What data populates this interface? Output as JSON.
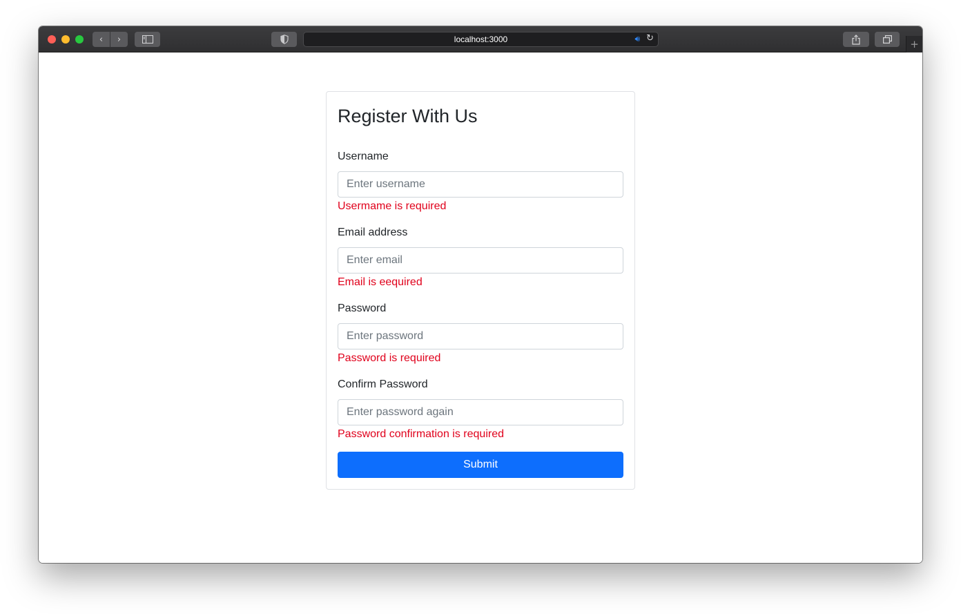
{
  "browser": {
    "address": "localhost:3000",
    "icons": {
      "back": "chevron-left-icon",
      "forward": "chevron-right-icon",
      "sidebar": "sidebar-icon",
      "shield": "shield-icon",
      "speaker": "speaker-icon",
      "reload": "reload-icon",
      "share": "share-icon",
      "tabs": "tabs-overview-icon",
      "new_tab": "plus-icon"
    }
  },
  "form": {
    "title": "Register With Us",
    "fields": [
      {
        "label": "Username",
        "placeholder": "Enter username",
        "value": "",
        "error": "Usermame is required"
      },
      {
        "label": "Email address",
        "placeholder": "Enter email",
        "value": "",
        "error": "Email is eequired"
      },
      {
        "label": "Password",
        "placeholder": "Enter password",
        "value": "",
        "error": "Password is required"
      },
      {
        "label": "Confirm Password",
        "placeholder": "Enter password again",
        "value": "",
        "error": "Password confirmation is required"
      }
    ],
    "submit_label": "Submit"
  },
  "colors": {
    "primary": "#0d6efd",
    "error": "#e0001b",
    "text": "#212529"
  }
}
